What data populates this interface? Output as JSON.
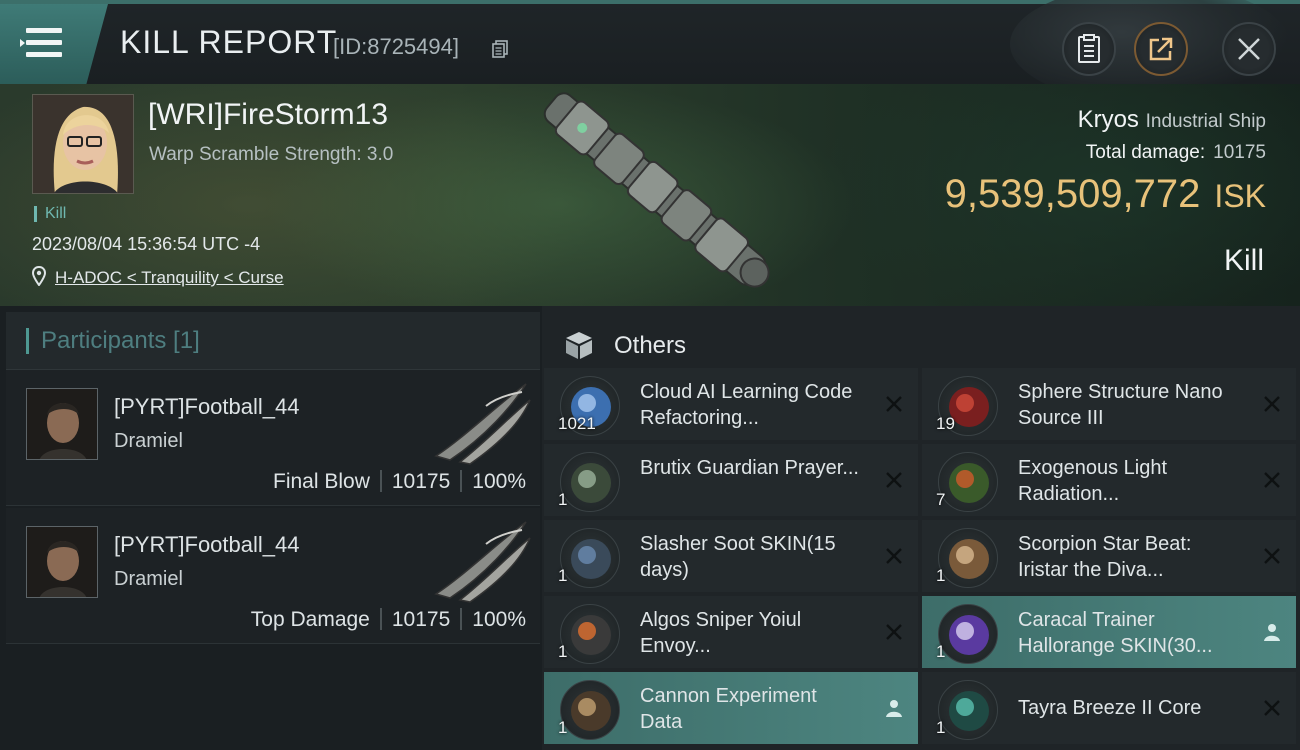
{
  "header": {
    "title": "KILL REPORT",
    "report_id": "[ID:8725494]",
    "menu_icon": "hamburger-menu-icon",
    "buttons": [
      "clipboard-icon",
      "share-icon",
      "close-icon"
    ]
  },
  "victim": {
    "name": "[WRI]FireStorm13",
    "warp_scramble": "Warp Scramble Strength: 3.0",
    "kill_tag": "Kill",
    "datetime": "2023/08/04 15:36:54 UTC -4",
    "location": "H-ADOC < Tranquility < Curse",
    "ship_name": "Kryos",
    "ship_class": "Industrial Ship",
    "total_damage_label": "Total damage:",
    "total_damage": "10175",
    "isk_value": "9,539,509,772",
    "isk_unit": "ISK",
    "result": "Kill"
  },
  "participants": {
    "header": "Participants [1]",
    "rows": [
      {
        "name": "[PYRT]Football_44",
        "ship": "Dramiel",
        "role": "Final Blow",
        "damage": "10175",
        "percent": "100%"
      },
      {
        "name": "[PYRT]Football_44",
        "ship": "Dramiel",
        "role": "Top Damage",
        "damage": "10175",
        "percent": "100%"
      }
    ]
  },
  "others": {
    "title": "Others",
    "items": [
      {
        "name": "Cloud AI Learning Code Refactoring...",
        "qty": "1021",
        "action": "close"
      },
      {
        "name": "Sphere Structure Nano Source III",
        "qty": "19",
        "action": "close"
      },
      {
        "name": "Brutix Guardian Prayer...",
        "qty": "1",
        "action": "close"
      },
      {
        "name": "Exogenous Light Radiation...",
        "qty": "7",
        "action": "close"
      },
      {
        "name": "Slasher Soot SKIN(15 days)",
        "qty": "1",
        "action": "close"
      },
      {
        "name": "Scorpion Star Beat: Iristar the Diva...",
        "qty": "1",
        "action": "close"
      },
      {
        "name": "Algos Sniper Yoiul Envoy...",
        "qty": "1",
        "action": "close"
      },
      {
        "name": "Caracal Trainer Hallorange SKIN(30...",
        "qty": "1",
        "action": "person"
      },
      {
        "name": "Cannon Experiment Data",
        "qty": "1",
        "action": "person"
      },
      {
        "name": "Tayra Breeze II Core",
        "qty": "1",
        "action": "close"
      }
    ]
  },
  "colors": {
    "accent_teal": "#4e9892",
    "isk_gold": "#e8c27a",
    "highlight_row": "#4d8580"
  }
}
